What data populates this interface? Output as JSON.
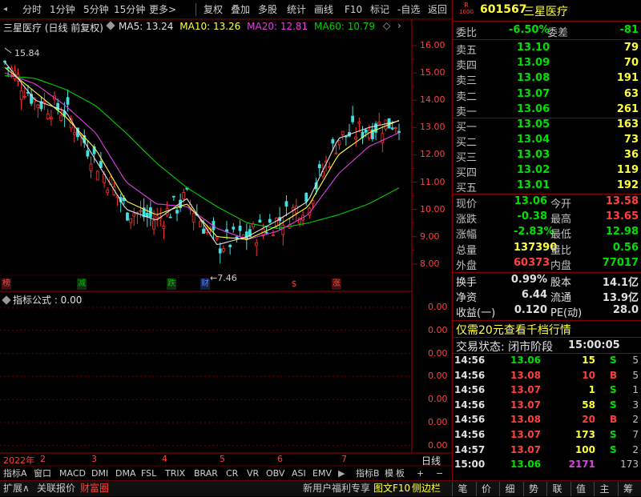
{
  "toolbar": {
    "items": [
      "分时",
      "1分钟",
      "5分钟",
      "15分钟",
      "更多>",
      "复权",
      "叠加",
      "多股",
      "统计",
      "画线",
      "F10",
      "标记",
      "-自选",
      "返回"
    ]
  },
  "chart": {
    "title": "三星医疗 (日线 前复权)",
    "ma5": "MA5: 13.24",
    "ma10": "MA10: 13.26",
    "ma20": "MA20: 12.81",
    "ma60": "MA60: 10.79",
    "high_label": "15.84",
    "low_label": "←7.46",
    "price_ticks": [
      "16.00",
      "15.00",
      "14.00",
      "13.00",
      "12.00",
      "11.00",
      "10.00",
      "9.00",
      "8.00"
    ],
    "markers": [
      {
        "text": "榜",
        "color": "#ff4040"
      },
      {
        "text": "减",
        "color": "#00c000"
      },
      {
        "text": "跌",
        "color": "#00c000"
      },
      {
        "text": "财",
        "color": "#6080ff"
      },
      {
        "text": "$",
        "color": "#ff4040"
      },
      {
        "text": "涨",
        "color": "#ff4040"
      }
    ],
    "indicator_label": "指标公式 : 0.00",
    "indicator_ticks": [
      "0.00",
      "0.00",
      "0.00",
      "0.00",
      "0.00",
      "0.00",
      "0.00"
    ],
    "dates": [
      "2022年",
      "2",
      "3",
      "4",
      "5",
      "6",
      "7"
    ],
    "period": "日线"
  },
  "chart_data": {
    "type": "line",
    "title": "三星医疗 (日线 前复权)",
    "x": [
      "2022年",
      "2",
      "3",
      "4",
      "5",
      "6",
      "7"
    ],
    "ylim": [
      7.5,
      16.5
    ],
    "series": [
      {
        "name": "MA5",
        "values": [
          15.4,
          14.0,
          13.6,
          11.8,
          10.0,
          9.6,
          10.4,
          8.7,
          9.0,
          9.6,
          10.3,
          12.6,
          13.0,
          13.24
        ]
      },
      {
        "name": "MA10",
        "values": [
          15.2,
          14.3,
          13.4,
          12.2,
          10.3,
          9.8,
          10.2,
          9.0,
          8.9,
          9.4,
          10.1,
          12.0,
          12.8,
          13.26
        ]
      },
      {
        "name": "MA20",
        "values": [
          15.0,
          14.6,
          13.8,
          12.8,
          11.0,
          10.2,
          10.1,
          9.3,
          8.9,
          9.2,
          9.8,
          11.3,
          12.3,
          12.81
        ]
      },
      {
        "name": "MA60",
        "values": [
          14.9,
          14.8,
          14.4,
          13.8,
          12.8,
          11.7,
          10.8,
          10.1,
          9.5,
          9.3,
          9.5,
          9.8,
          10.2,
          10.79
        ]
      }
    ]
  },
  "quote": {
    "code": "601567",
    "name": "三星医疗",
    "code_tag_top": "R",
    "code_tag_bottom": "1000",
    "weibi_label": "委比",
    "weibi_value": "-6.50%",
    "weicha_label": "委差",
    "weicha_value": "-81",
    "sells": [
      {
        "label": "卖五",
        "price": "13.10",
        "vol": "79"
      },
      {
        "label": "卖四",
        "price": "13.09",
        "vol": "70"
      },
      {
        "label": "卖三",
        "price": "13.08",
        "vol": "191"
      },
      {
        "label": "卖二",
        "price": "13.07",
        "vol": "63"
      },
      {
        "label": "卖一",
        "price": "13.06",
        "vol": "261"
      }
    ],
    "buys": [
      {
        "label": "买一",
        "price": "13.05",
        "vol": "163"
      },
      {
        "label": "买二",
        "price": "13.04",
        "vol": "73"
      },
      {
        "label": "买三",
        "price": "13.03",
        "vol": "36"
      },
      {
        "label": "买四",
        "price": "13.02",
        "vol": "119"
      },
      {
        "label": "买五",
        "price": "13.01",
        "vol": "192"
      }
    ],
    "stats": [
      {
        "l1": "现价",
        "v1": "13.06",
        "c1": "#00e000",
        "l2": "今开",
        "v2": "13.58",
        "c2": "#ff4040"
      },
      {
        "l1": "涨跌",
        "v1": "-0.38",
        "c1": "#00e000",
        "l2": "最高",
        "v2": "13.65",
        "c2": "#ff4040"
      },
      {
        "l1": "涨幅",
        "v1": "-2.83%",
        "c1": "#00e000",
        "l2": "最低",
        "v2": "12.98",
        "c2": "#00e000"
      },
      {
        "l1": "总量",
        "v1": "137390",
        "c1": "#ffff40",
        "l2": "量比",
        "v2": "0.56",
        "c2": "#00e000"
      },
      {
        "l1": "外盘",
        "v1": "60373",
        "c1": "#ff4040",
        "l2": "内盘",
        "v2": "77017",
        "c2": "#00e000"
      }
    ],
    "extra": [
      {
        "l1": "换手",
        "v1": "0.99%",
        "l2": "股本",
        "v2": "14.1亿"
      },
      {
        "l1": "净资",
        "v1": "6.44",
        "l2": "流通",
        "v2": "13.9亿"
      },
      {
        "l1": "收益(一)",
        "v1": "0.120",
        "l2": "PE(动)",
        "v2": "28.0"
      }
    ],
    "promo": "仅需20元查看千档行情",
    "status_label": "交易状态: 闭市阶段",
    "status_time": "15:00:05",
    "ticks": [
      {
        "time": "14:56",
        "price": "13.06",
        "vol": "15",
        "bs": "S",
        "n": "5"
      },
      {
        "time": "14:56",
        "price": "13.08",
        "vol": "10",
        "bs": "B",
        "n": "5"
      },
      {
        "time": "14:56",
        "price": "13.07",
        "vol": "1",
        "bs": "S",
        "n": "1"
      },
      {
        "time": "14:56",
        "price": "13.07",
        "vol": "58",
        "bs": "S",
        "n": "3"
      },
      {
        "time": "14:56",
        "price": "13.08",
        "vol": "20",
        "bs": "B",
        "n": "2"
      },
      {
        "time": "14:56",
        "price": "13.07",
        "vol": "173",
        "bs": "S",
        "n": "7"
      },
      {
        "time": "14:57",
        "price": "13.07",
        "vol": "100",
        "bs": "S",
        "n": "2"
      },
      {
        "time": "15:00",
        "price": "13.06",
        "vol": "2171",
        "bs": "",
        "n": "173"
      }
    ]
  },
  "indicator_tabs": [
    "指标A",
    "窗口",
    "MACD",
    "DMI",
    "DMA",
    "FSL",
    "TRIX",
    "BRAR",
    "CR",
    "VR",
    "OBV",
    "ASI",
    "EMV"
  ],
  "indicator_tabs_right": [
    "指标B",
    "模",
    "板"
  ],
  "bottom": {
    "left": [
      "扩展∧",
      "关联报价",
      "财富圈"
    ],
    "right_text": "新用户福利专享",
    "f10": "图文F10",
    "sidebar": "侧边栏",
    "right_tabs": [
      "笔",
      "价",
      "细",
      "势",
      "联",
      "值",
      "主",
      "筹"
    ]
  }
}
